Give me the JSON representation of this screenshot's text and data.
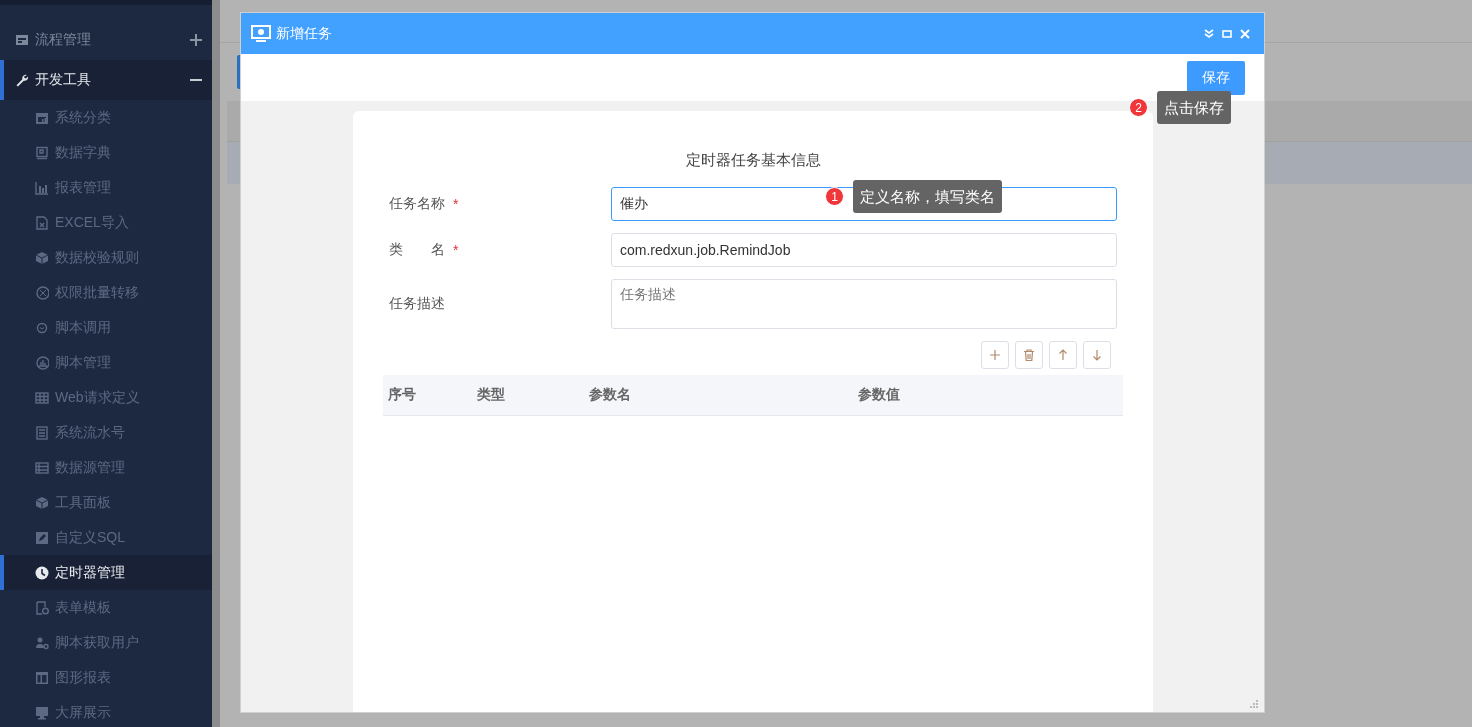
{
  "sidebar": {
    "items": [
      {
        "label": "流程管理",
        "expanded": false
      },
      {
        "label": "开发工具",
        "expanded": true,
        "children": [
          {
            "label": "系统分类",
            "selected": false
          },
          {
            "label": "数据字典",
            "selected": false
          },
          {
            "label": "报表管理",
            "selected": false
          },
          {
            "label": "EXCEL导入",
            "selected": false
          },
          {
            "label": "数据校验规则",
            "selected": false
          },
          {
            "label": "权限批量转移",
            "selected": false
          },
          {
            "label": "脚本调用",
            "selected": false
          },
          {
            "label": "脚本管理",
            "selected": false
          },
          {
            "label": "Web请求定义",
            "selected": false
          },
          {
            "label": "系统流水号",
            "selected": false
          },
          {
            "label": "数据源管理",
            "selected": false
          },
          {
            "label": "工具面板",
            "selected": false
          },
          {
            "label": "自定义SQL",
            "selected": false
          },
          {
            "label": "定时器管理",
            "selected": true
          },
          {
            "label": "表单模板",
            "selected": false
          },
          {
            "label": "脚本获取用户",
            "selected": false
          },
          {
            "label": "图形报表",
            "selected": false
          },
          {
            "label": "大屏展示",
            "selected": false
          }
        ]
      }
    ]
  },
  "dialog": {
    "title": "新增任务",
    "save_button": "保存",
    "form": {
      "title": "定时器任务基本信息",
      "fields": [
        {
          "kind": "input",
          "label": "任务名称",
          "required_mark": "*",
          "value": "催办",
          "focused": true
        },
        {
          "kind": "input",
          "label": "类　　名",
          "required_mark": "*",
          "value": "com.redxun.job.RemindJob",
          "focused": false
        },
        {
          "kind": "textarea",
          "label": "任务描述",
          "placeholder": "任务描述",
          "focused": false
        }
      ],
      "table": {
        "columns": [
          "序号",
          "类型",
          "参数名",
          "参数值"
        ]
      }
    }
  },
  "callouts": [
    {
      "number": "1",
      "text": "定义名称，填写类名"
    },
    {
      "number": "2",
      "text": "点击保存"
    }
  ]
}
